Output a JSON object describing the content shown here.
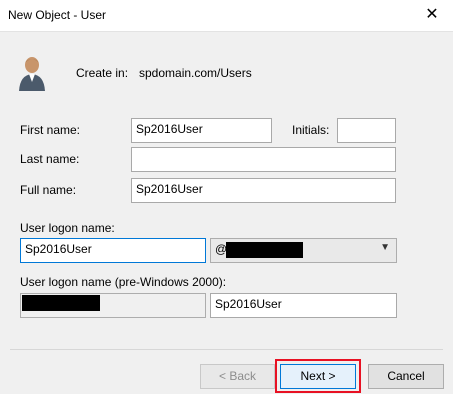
{
  "window": {
    "title": "New Object - User",
    "close_icon": "close-icon"
  },
  "header": {
    "create_in_label": "Create in:",
    "create_in_value": "spdomain.com/Users",
    "icon": "user-icon"
  },
  "form": {
    "first_name": {
      "label": "First name:",
      "value": "Sp2016User"
    },
    "initials": {
      "label": "Initials:",
      "value": ""
    },
    "last_name": {
      "label": "Last name:",
      "value": ""
    },
    "full_name": {
      "label": "Full name:",
      "value": "Sp2016User"
    },
    "logon": {
      "label": "User logon name:",
      "value": "Sp2016User",
      "domain_prefix": "@"
    },
    "pre2000": {
      "label": "User logon name (pre-Windows 2000):",
      "value": "Sp2016User"
    }
  },
  "buttons": {
    "back": "< Back",
    "next": "Next >",
    "cancel": "Cancel"
  },
  "colors": {
    "highlight": "#e81123",
    "focus": "#0078d7"
  }
}
